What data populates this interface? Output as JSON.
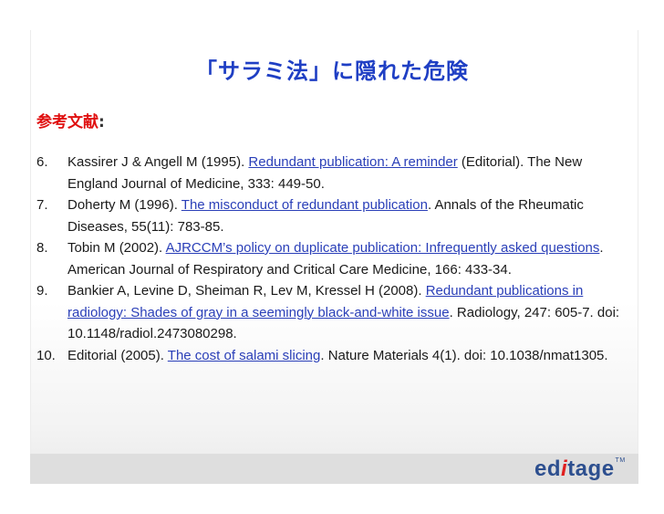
{
  "slide": {
    "title": "「サラミ法」に隠れた危険",
    "heading": "参考文献",
    "heading_colon": ":"
  },
  "references": [
    {
      "num": "6.",
      "before": "Kassirer J & Angell M (1995). ",
      "link": "Redundant publication: A reminder",
      "after": " (Editorial). The New England Journal of Medicine, 333: 449-50."
    },
    {
      "num": "7.",
      "before": "Doherty M (1996). ",
      "link": "The misconduct of redundant publication",
      "after": ". Annals of the Rheumatic Diseases, 55(11): 783-85."
    },
    {
      "num": "8.",
      "before": "Tobin M (2002). ",
      "link": "AJRCCM’s policy on duplicate publication: Infrequently asked questions",
      "after": ". American Journal of Respiratory and Critical Care Medicine, 166: 433-34."
    },
    {
      "num": "9.",
      "before": "Bankier A, Levine D, Sheiman R, Lev M, Kressel H (2008). ",
      "link": "Redundant publications in radiology: Shades of gray in a seemingly black-and-white issue",
      "after": ". Radiology, 247: 605-7. doi: 10.1148/radiol.2473080298."
    },
    {
      "num": "10.",
      "before": "Editorial (2005). ",
      "link": "The cost of salami slicing",
      "after": ". Nature Materials 4(1). doi: 10.1038/nmat1305."
    }
  ],
  "logo": {
    "ed": "ed",
    "i": "i",
    "tage": "tage",
    "tm": "TM"
  },
  "colors": {
    "title": "#1f3fc4",
    "heading": "#e01010",
    "link": "#2a3fb8",
    "logo": "#2d4f8f",
    "logo_accent": "#e02020",
    "footer_bar": "#dedede"
  }
}
